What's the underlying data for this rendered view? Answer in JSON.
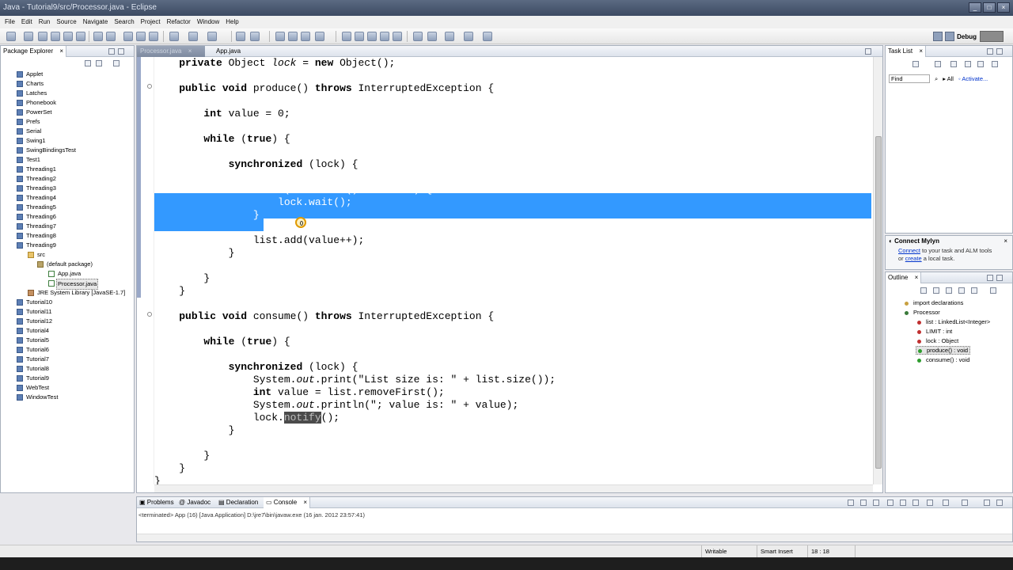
{
  "window": {
    "title": "Java - Tutorial9/src/Processor.java - Eclipse",
    "buttons": [
      "_",
      "□",
      "×"
    ]
  },
  "menu": [
    "File",
    "Edit",
    "Run",
    "Source",
    "Navigate",
    "Search",
    "Project",
    "Refactor",
    "Window",
    "Help"
  ],
  "toolbar": {
    "perspective_label": "Debug"
  },
  "package_explorer": {
    "title": "Package Explorer",
    "projects_top": [
      "Applet",
      "Charts",
      "Latches",
      "Phonebook",
      "PowerSet",
      "Prefs",
      "Serial",
      "Swing1",
      "SwingBindingsTest",
      "Test1",
      "Threading1",
      "Threading2",
      "Threading3",
      "Threading4",
      "Threading5",
      "Threading6",
      "Threading7",
      "Threading8",
      "Threading9"
    ],
    "expanded": {
      "src": "src",
      "package": "(default package)",
      "files": [
        "App.java",
        "Processor.java"
      ],
      "library": "JRE System Library [JavaSE-1.7]"
    },
    "projects_bottom": [
      "Tutorial10",
      "Tutorial11",
      "Tutorial12",
      "Tutorial4",
      "Tutorial5",
      "Tutorial6",
      "Tutorial7",
      "Tutorial8",
      "Tutorial9",
      "WebTest",
      "WindowTest"
    ]
  },
  "editor": {
    "tabs": [
      {
        "label": "Processor.java",
        "close": "×"
      },
      {
        "label": "App.java"
      }
    ],
    "lines": [
      "    private Object lock = new Object();",
      "",
      "    public void produce() throws InterruptedException {",
      "",
      "        int value = 0;",
      "",
      "        while (true) {",
      "",
      "            synchronized (lock) {",
      "",
      "                while(list.size() == LIMIT) {",
      "                    lock.wait();",
      "                }",
      "",
      "                list.add(value++);",
      "            }",
      "",
      "        }",
      "    }",
      "",
      "    public void consume() throws InterruptedException {",
      "",
      "        while (true) {",
      "",
      "            synchronized (lock) {",
      "                System.out.print(\"List size is: \" + list.size());",
      "                int value = list.removeFirst();",
      "                System.out.println(\"; value is: \" + value);",
      "                lock.notify();",
      "            }",
      "",
      "        }",
      "    }",
      "}"
    ]
  },
  "task_list": {
    "title": "Task List",
    "find_placeholder": "Find",
    "all": "All",
    "activate": "Activate..."
  },
  "mylyn": {
    "title": "Connect Mylyn",
    "connect": "Connect",
    "text1": " to your task and ALM tools",
    "text2": "or ",
    "create": "create",
    "text3": " a local task."
  },
  "outline": {
    "title": "Outline",
    "items": [
      "import declarations",
      "Processor",
      "list : LinkedList<Integer>",
      "LIMIT : int",
      "lock : Object",
      "produce() : void",
      "consume() : void"
    ]
  },
  "console": {
    "tabs": [
      "Problems",
      "Javadoc",
      "Declaration",
      "Console"
    ],
    "console_close": "×",
    "status": "<terminated> App (16) [Java Application] D:\\jre7\\bin\\javaw.exe (16 jan. 2012 23:57:41)"
  },
  "status": {
    "writable": "Writable",
    "insert": "Smart Insert",
    "position": "18 : 18"
  }
}
